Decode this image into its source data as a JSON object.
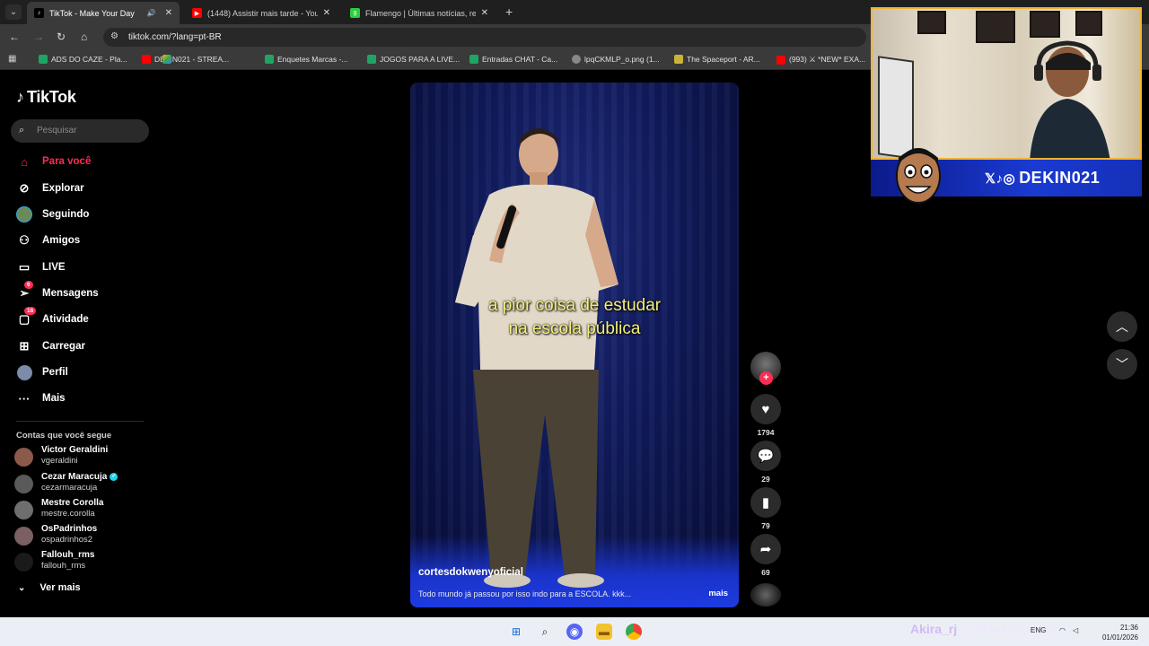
{
  "browser": {
    "tabs": [
      {
        "title": "TikTok - Make Your Day",
        "active": true,
        "audio": true
      },
      {
        "title": "(1448) Assistir mais tarde - YouTube",
        "active": false
      },
      {
        "title": "Flamengo | Últimas notícias, re",
        "active": false
      }
    ],
    "url": "tiktok.com/?lang=pt-BR",
    "bookmarks": [
      "ADS DO CAZE - Pla...",
      "DEKIN021 - STREA...",
      "Enquetes Marcas -...",
      "JOGOS PARA A LIVE...",
      "Entradas CHAT - Ca...",
      "lpqCKMLP_o.png (1...",
      "The Spaceport - AR...",
      "(993) ⚔ *NEW* EXA..."
    ]
  },
  "tiktok": {
    "logo": "TikTok",
    "search_placeholder": "Pesquisar",
    "nav": [
      {
        "label": "Para você",
        "icon": "home-icon",
        "active": true
      },
      {
        "label": "Explorar",
        "icon": "compass-icon"
      },
      {
        "label": "Seguindo",
        "icon": "following-avatar-icon"
      },
      {
        "label": "Amigos",
        "icon": "friends-icon"
      },
      {
        "label": "LIVE",
        "icon": "live-tv-icon"
      },
      {
        "label": "Mensagens",
        "icon": "messages-icon",
        "badge": "6"
      },
      {
        "label": "Atividade",
        "icon": "activity-icon",
        "badge": "16"
      },
      {
        "label": "Carregar",
        "icon": "upload-icon"
      },
      {
        "label": "Perfil",
        "icon": "profile-icon"
      },
      {
        "label": "Mais",
        "icon": "more-icon"
      }
    ],
    "following_title": "Contas que você segue",
    "following": [
      {
        "name": "Victor Geraldini",
        "handle": "vgeraldini",
        "verified": false
      },
      {
        "name": "Cezar Maracuja",
        "handle": "cezarmaracuja",
        "verified": true
      },
      {
        "name": "Mestre Corolla",
        "handle": "mestre.corolla",
        "verified": false
      },
      {
        "name": "OsPadrinhos",
        "handle": "ospadrinhos2",
        "verified": false
      },
      {
        "name": "Fallouh_rms",
        "handle": "fallouh_rms",
        "verified": false
      }
    ],
    "see_more": "Ver mais",
    "video": {
      "caption_line1": "a pior coisa de estudar",
      "caption_line2": "na escola pública",
      "author": "cortesdokwenyoficial",
      "description": "Todo mundo já passou por isso indo para a ESCOLA. kkk...",
      "more": "mais"
    },
    "actions": {
      "likes": "1794",
      "comments": "29",
      "saves": "79",
      "shares": "69"
    }
  },
  "stream_overlay": {
    "brand": "DEKIN021",
    "chat_name": "Akira_rj",
    "chat_text": ": cckkkkkkkkkkkkkk"
  },
  "taskbar": {
    "lang": "ENG",
    "time": "21:36",
    "date": "01/01/2026"
  },
  "colors": {
    "accent": "#fe2c55",
    "caption": "#f4f07a",
    "banner": "#1a3ad1"
  }
}
